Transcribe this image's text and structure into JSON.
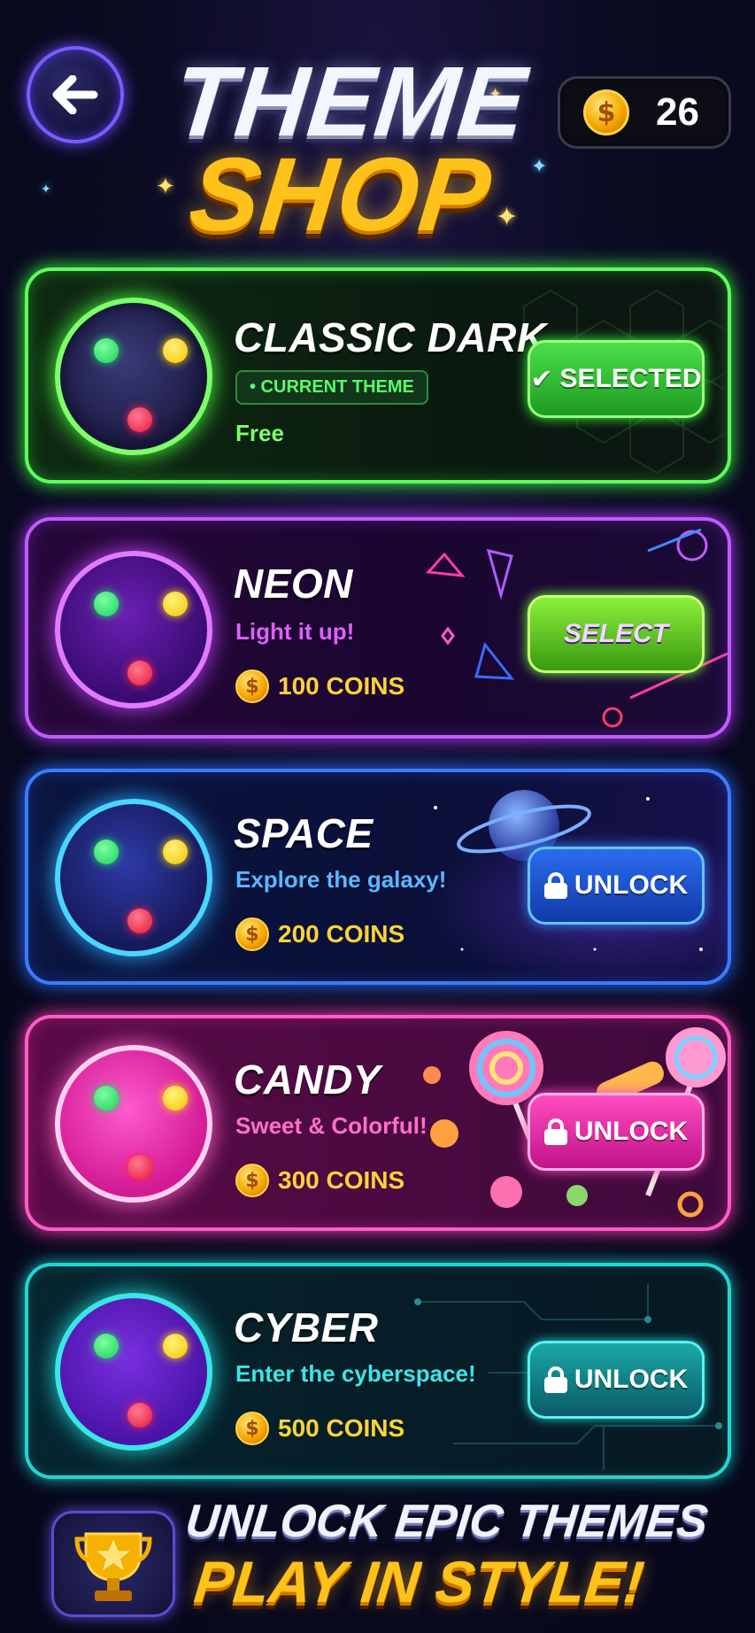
{
  "header": {
    "back_icon": "arrow-left-icon",
    "title_line1": "THEME",
    "title_line2": "SHOP",
    "coin_symbol": "$",
    "coin_balance": "26"
  },
  "themes": [
    {
      "name": "CLASSIC DARK",
      "badge": "• CURRENT THEME",
      "price_label": "Free",
      "button_label": "SELECTED",
      "button_icon": "check-icon",
      "state": "selected",
      "accent": "#5cff5a"
    },
    {
      "name": "NEON",
      "subtitle": "Light it up!",
      "coin_symbol": "$",
      "price_label": "100 COINS",
      "button_label": "SELECT",
      "state": "owned",
      "accent": "#c05cff"
    },
    {
      "name": "SPACE",
      "subtitle": "Explore the galaxy!",
      "coin_symbol": "$",
      "price_label": "200 COINS",
      "button_label": "UNLOCK",
      "button_icon": "lock-icon",
      "state": "locked",
      "accent": "#3a7cff"
    },
    {
      "name": "CANDY",
      "subtitle": "Sweet & Colorful!",
      "coin_symbol": "$",
      "price_label": "300 COINS",
      "button_label": "UNLOCK",
      "button_icon": "lock-icon",
      "state": "locked",
      "accent": "#ff5cc8"
    },
    {
      "name": "CYBER",
      "subtitle": "Enter the cyberspace!",
      "coin_symbol": "$",
      "price_label": "500 COINS",
      "button_label": "UNLOCK",
      "button_icon": "lock-icon",
      "state": "locked",
      "accent": "#20d6d0"
    }
  ],
  "footer": {
    "icon": "trophy-star-icon",
    "line1": "UNLOCK EPIC THEMES",
    "line2": "PLAY IN STYLE!"
  }
}
